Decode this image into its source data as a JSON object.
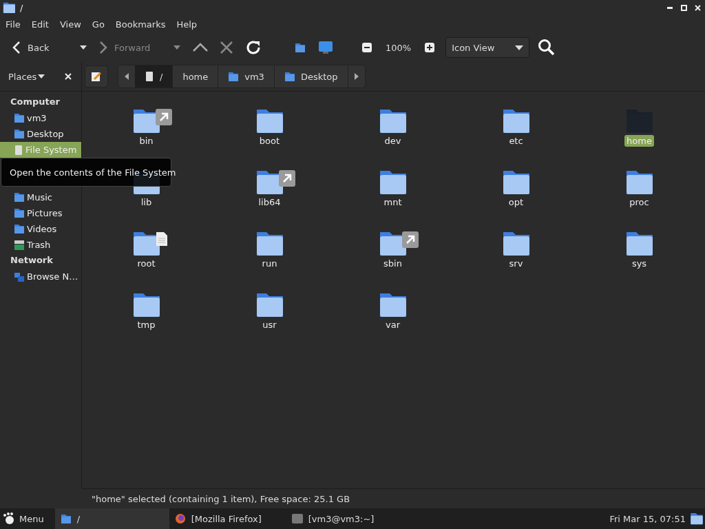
{
  "window": {
    "title": "/"
  },
  "menu": [
    "File",
    "Edit",
    "View",
    "Go",
    "Bookmarks",
    "Help"
  ],
  "toolbar": {
    "back": {
      "label": "Back",
      "disabled": false
    },
    "forward": {
      "label": "Forward",
      "disabled": true
    },
    "up": {
      "disabled": false
    },
    "stop": {
      "disabled": true
    },
    "zoom": "100%",
    "view": "Icon View"
  },
  "places": {
    "label": "Places"
  },
  "breadcrumbs": [
    {
      "label": "/",
      "kind": "root",
      "selected": true
    },
    {
      "label": "home",
      "kind": "plain",
      "selected": false
    },
    {
      "label": "vm3",
      "kind": "home",
      "selected": false
    },
    {
      "label": "Desktop",
      "kind": "desktop",
      "selected": false
    }
  ],
  "sidebar": [
    {
      "title": "Computer",
      "items": [
        {
          "label": "vm3",
          "kind": "home",
          "selected": false
        },
        {
          "label": "Desktop",
          "kind": "desktop",
          "selected": false
        },
        {
          "label": "File System",
          "kind": "drive",
          "selected": true
        },
        {
          "label": "Music",
          "kind": "music",
          "selected": false
        },
        {
          "label": "Pictures",
          "kind": "pictures",
          "selected": false
        },
        {
          "label": "Videos",
          "kind": "videos",
          "selected": false
        },
        {
          "label": "Trash",
          "kind": "trash",
          "selected": false
        }
      ]
    },
    {
      "title": "Network",
      "items": [
        {
          "label": "Browse N…",
          "kind": "network",
          "selected": false
        }
      ]
    }
  ],
  "tooltip": "Open the contents of the File System",
  "files": [
    {
      "name": "bin",
      "kind": "shortcut",
      "selected": false
    },
    {
      "name": "boot",
      "kind": "plain",
      "selected": false
    },
    {
      "name": "dev",
      "kind": "plain",
      "selected": false
    },
    {
      "name": "etc",
      "kind": "plain",
      "selected": false
    },
    {
      "name": "home",
      "kind": "plain",
      "selected": true
    },
    {
      "name": "lib",
      "kind": "plain",
      "selected": false
    },
    {
      "name": "lib64",
      "kind": "shortcut",
      "selected": false
    },
    {
      "name": "mnt",
      "kind": "plain",
      "selected": false
    },
    {
      "name": "opt",
      "kind": "plain",
      "selected": false
    },
    {
      "name": "proc",
      "kind": "plain",
      "selected": false
    },
    {
      "name": "root",
      "kind": "document",
      "selected": false
    },
    {
      "name": "run",
      "kind": "plain",
      "selected": false
    },
    {
      "name": "sbin",
      "kind": "shortcut",
      "selected": false
    },
    {
      "name": "srv",
      "kind": "plain",
      "selected": false
    },
    {
      "name": "sys",
      "kind": "plain",
      "selected": false
    },
    {
      "name": "tmp",
      "kind": "plain",
      "selected": false
    },
    {
      "name": "usr",
      "kind": "plain",
      "selected": false
    },
    {
      "name": "var",
      "kind": "plain",
      "selected": false
    }
  ],
  "status": "\"home\" selected (containing 1 item), Free space: 25.1 GB",
  "taskbar": {
    "menu": "Menu",
    "tasks": [
      {
        "label": "/",
        "kind": "folder",
        "selected": true
      },
      {
        "label": "[Mozilla Firefox]",
        "kind": "browser",
        "selected": false
      },
      {
        "label": "[vm3@vm3:~]",
        "kind": "terminal",
        "selected": false
      }
    ],
    "clock": "Fri Mar 15, 07:51"
  }
}
